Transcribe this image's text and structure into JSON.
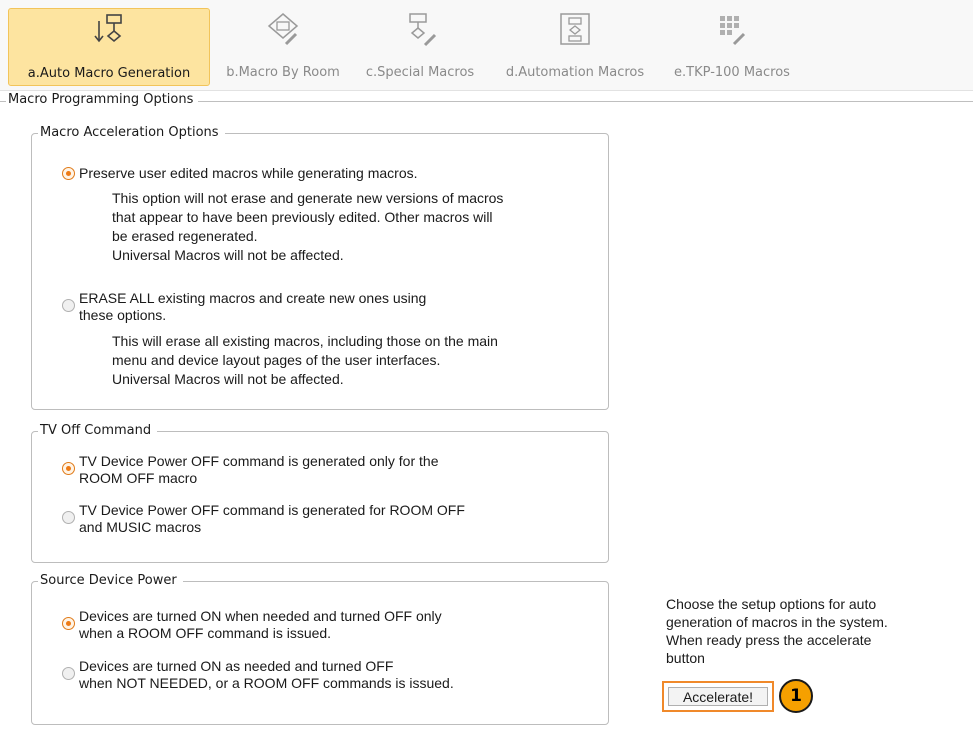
{
  "tabs": [
    {
      "label": "a.Auto Macro Generation",
      "icon": "flowchart-arrow-icon",
      "active": true
    },
    {
      "label": "b.Macro By Room",
      "icon": "room-edit-icon",
      "active": false
    },
    {
      "label": "c.Special Macros",
      "icon": "special-macro-edit-icon",
      "active": false
    },
    {
      "label": "d.Automation Macros",
      "icon": "automation-flow-icon",
      "active": false
    },
    {
      "label": "e.TKP-100 Macros",
      "icon": "keypad-edit-icon",
      "active": false
    }
  ],
  "outer_group": {
    "title": "Macro Programming Options"
  },
  "acceleration": {
    "title": "Macro Acceleration Options",
    "option1": {
      "label": "Preserve user edited macros while generating macros.",
      "checked": true,
      "desc": [
        "This option will not erase and generate new versions of macros",
        "that appear to have been previously edited. Other macros will",
        "be erased regenerated.",
        "Universal Macros will not be affected."
      ]
    },
    "option2": {
      "label_line1": "ERASE ALL existing macros and create new ones using",
      "label_line2": "these options.",
      "checked": false,
      "desc": [
        "This will erase all existing macros, including those on the main",
        "menu and device layout pages of the user interfaces.",
        "Universal Macros will not be affected."
      ]
    }
  },
  "tv_off": {
    "title": "TV Off Command",
    "option1": {
      "line1": "TV Device Power OFF command is generated only for the",
      "line2": "ROOM OFF macro",
      "checked": true
    },
    "option2": {
      "line1": "TV Device Power OFF command is generated for ROOM OFF",
      "line2": "and MUSIC macros",
      "checked": false
    }
  },
  "source_power": {
    "title": "Source Device Power",
    "option1": {
      "line1": "Devices are turned ON when needed and turned OFF only",
      "line2": "when a ROOM OFF command is issued.",
      "checked": true
    },
    "option2": {
      "line1": "Devices are turned ON as needed and turned OFF",
      "line2": "when NOT NEEDED, or a ROOM OFF commands is issued.",
      "checked": false
    }
  },
  "side_panel": {
    "lines": [
      "Choose the setup options for auto",
      "generation of macros in the system.",
      "When ready press the accelerate",
      "button"
    ],
    "button_label": "Accelerate!",
    "callout_number": "1"
  },
  "colors": {
    "accent": "#f0892a",
    "active_tab": "#fde4a0",
    "radio_checked": "#ee7a15",
    "callout": "#f6a000"
  }
}
